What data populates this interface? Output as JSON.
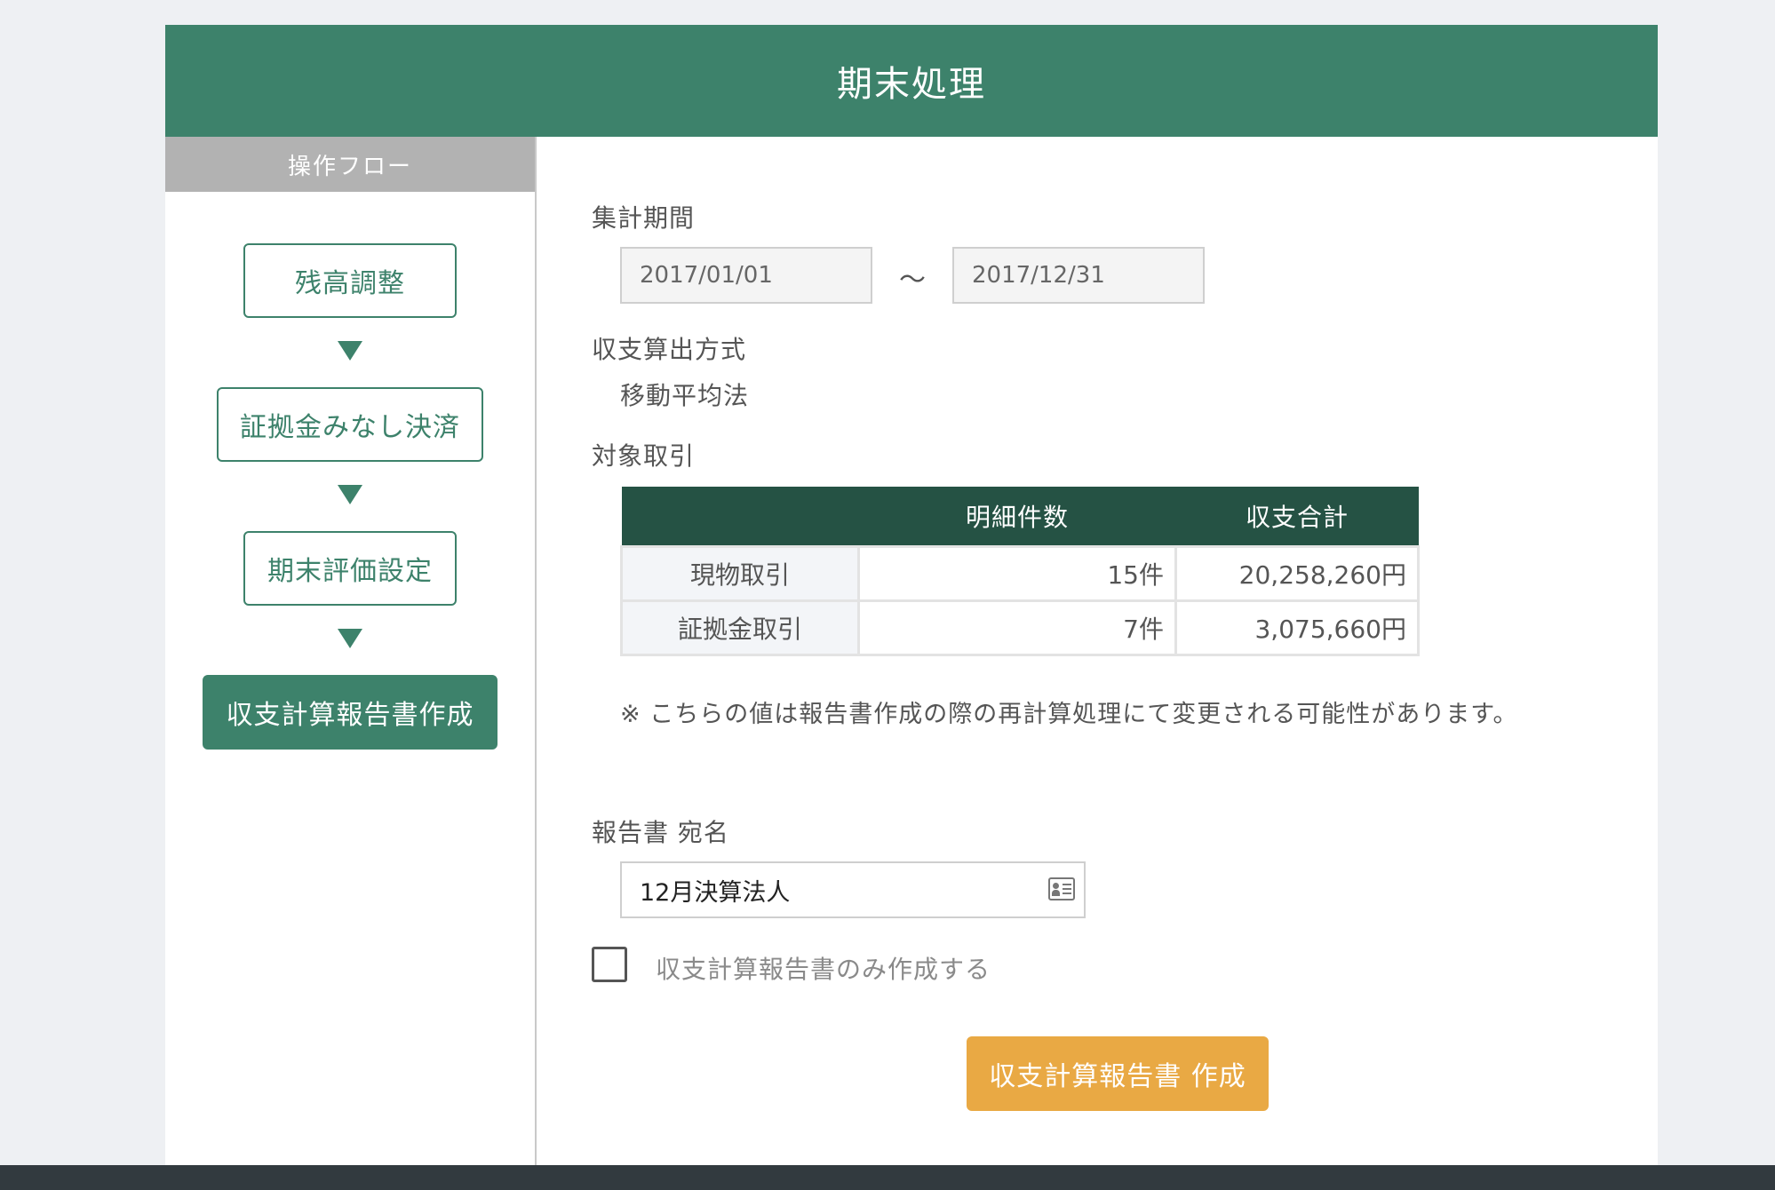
{
  "header": {
    "title": "期末処理"
  },
  "sidebar": {
    "title": "操作フロー",
    "steps": [
      {
        "label": "残高調整",
        "active": false
      },
      {
        "label": "証拠金みなし決済",
        "active": false
      },
      {
        "label": "期末評価設定",
        "active": false
      },
      {
        "label": "収支計算報告書作成",
        "active": true
      }
    ]
  },
  "period": {
    "label": "集計期間",
    "start": "2017/01/01",
    "separator": "〜",
    "end": "2017/12/31"
  },
  "method": {
    "label": "収支算出方式",
    "value": "移動平均法"
  },
  "transactions": {
    "label": "対象取引",
    "columns": [
      "",
      "明細件数",
      "収支合計"
    ],
    "rows": [
      {
        "category": "現物取引",
        "count": "15件",
        "total": "20,258,260円"
      },
      {
        "category": "証拠金取引",
        "count": "7件",
        "total": "3,075,660円"
      }
    ]
  },
  "note": "※ こちらの値は報告書作成の際の再計算処理にて変更される可能性があります。",
  "recipient": {
    "label": "報告書 宛名",
    "value": "12月決算法人",
    "icon": "contact-card-icon"
  },
  "only_report_checkbox": {
    "label": "収支計算報告書のみ作成する",
    "checked": false
  },
  "create_button": {
    "label": "収支計算報告書 作成"
  },
  "colors": {
    "header": "#3d826b",
    "table_header": "#255244",
    "button": "#e9a944",
    "footer": "#323a3f"
  }
}
